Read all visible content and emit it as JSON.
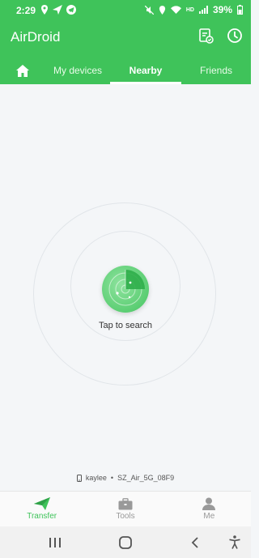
{
  "status_bar": {
    "time": "2:29",
    "battery": "39%",
    "network": "HD"
  },
  "app_bar": {
    "title": "AirDroid"
  },
  "tabs": [
    {
      "label": ""
    },
    {
      "label": "My devices"
    },
    {
      "label": "Nearby"
    },
    {
      "label": "Friends"
    }
  ],
  "main": {
    "search_label": "Tap to search",
    "device_name": "kaylee",
    "separator": "•",
    "wifi_name": "SZ_Air_5G_08F9"
  },
  "bottom_nav": [
    {
      "label": "Transfer"
    },
    {
      "label": "Tools"
    },
    {
      "label": "Me"
    }
  ],
  "colors": {
    "accent": "#3fc35a",
    "background": "#f4f6f8"
  }
}
